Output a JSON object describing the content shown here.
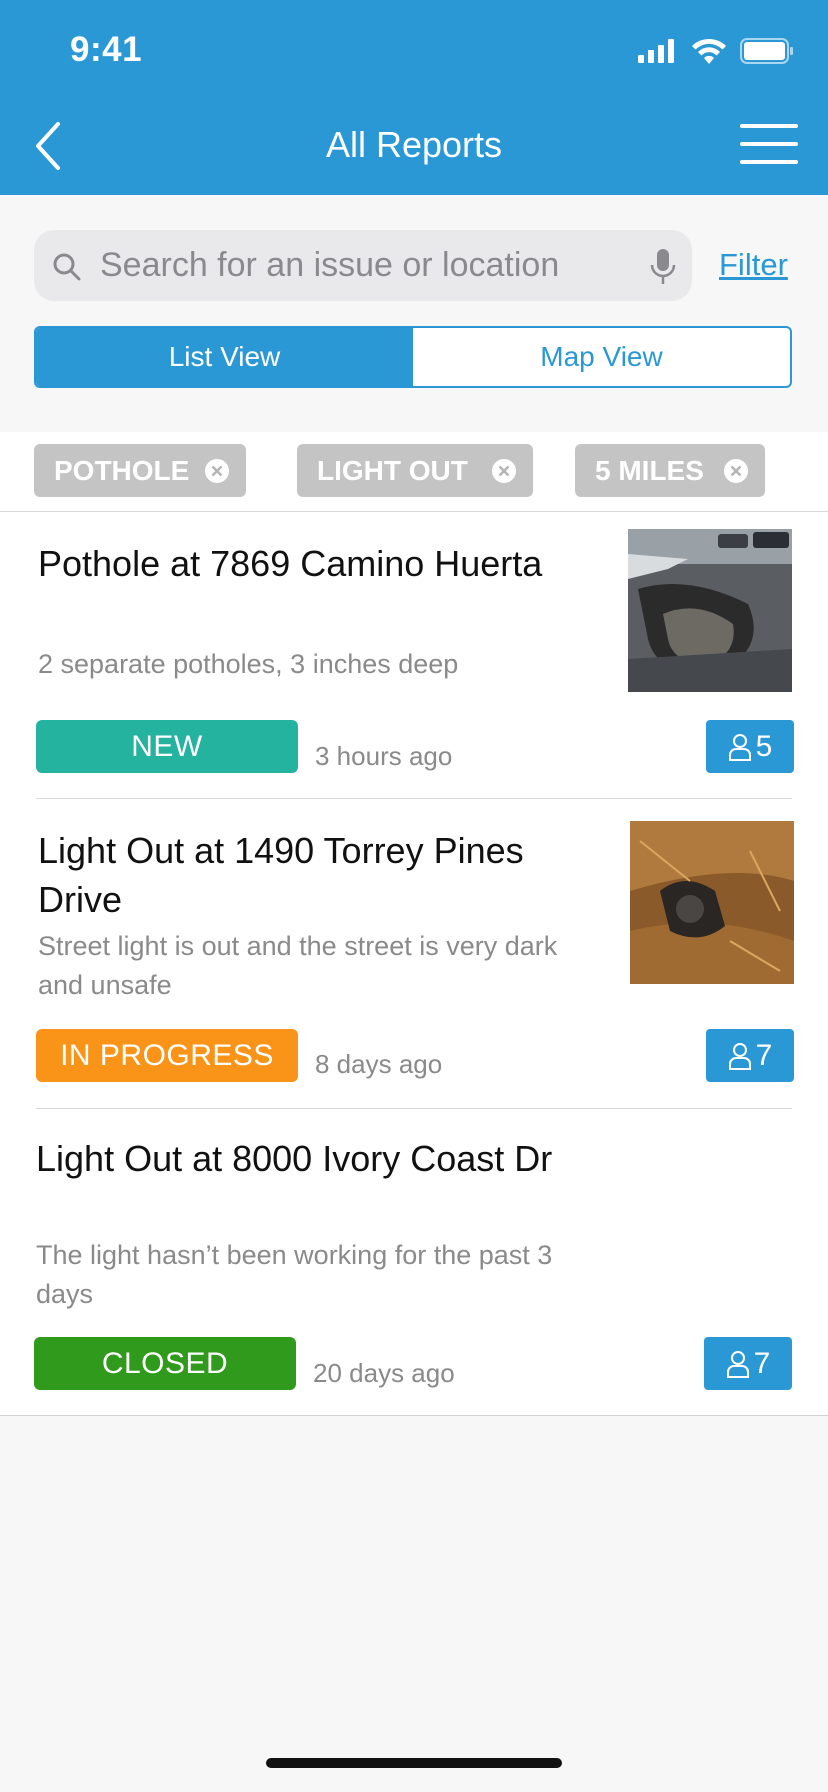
{
  "status_bar": {
    "time": "9:41"
  },
  "header": {
    "title": "All Reports"
  },
  "search": {
    "placeholder": "Search for an issue or location",
    "filter_label": "Filter"
  },
  "segmented": {
    "list_label": "List View",
    "map_label": "Map View"
  },
  "chips": [
    {
      "label": "POTHOLE"
    },
    {
      "label": "LIGHT OUT"
    },
    {
      "label": "5 MILES"
    }
  ],
  "reports": [
    {
      "title": "Pothole at 7869 Camino Huerta",
      "description": "2 separate potholes, 3 inches deep",
      "status": "NEW",
      "status_color": "#23b39f",
      "time_ago": "3 hours ago",
      "count": "5"
    },
    {
      "title": "Light Out at 1490 Torrey Pines Drive",
      "description": "Street light is out and the street is very dark and unsafe",
      "status": "IN PROGRESS",
      "status_color": "#fa9419",
      "time_ago": "8 days ago",
      "count": "7"
    },
    {
      "title": "Light Out at 8000 Ivory Coast Dr",
      "description": "The light hasn’t been working for the past 3 days",
      "status": "CLOSED",
      "status_color": "#309a1c",
      "time_ago": "20 days ago",
      "count": "7"
    }
  ],
  "colors": {
    "brand": "#2b98d6",
    "chip": "#c4c4c4"
  }
}
